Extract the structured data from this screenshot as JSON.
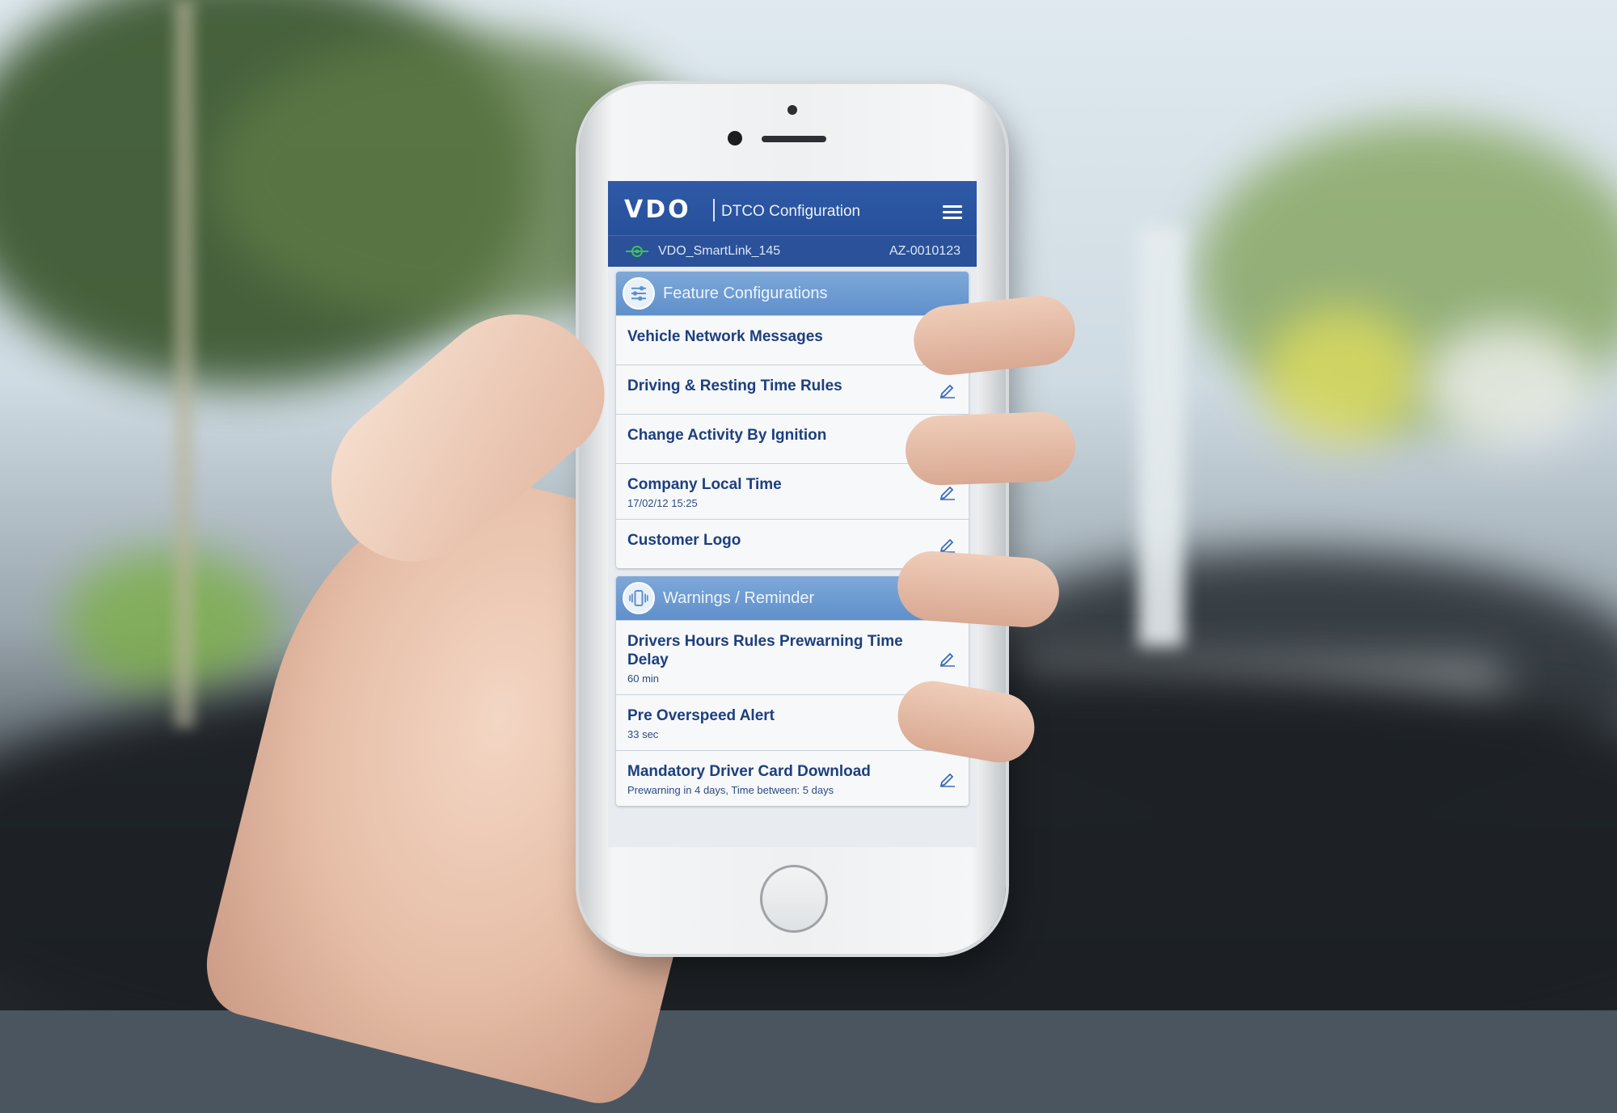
{
  "header": {
    "logo": "VDO",
    "title": "DTCO Configuration",
    "device_name": "VDO_SmartLink_145",
    "serial": "AZ-0010123",
    "menu_icon": "hamburger-menu-icon",
    "connection_icon": "bluetooth-link-icon"
  },
  "feature_configurations": {
    "heading": "Feature Configurations",
    "icon": "sliders-icon",
    "items": [
      {
        "title": "Vehicle Network Messages",
        "subtitle": ""
      },
      {
        "title": "Driving & Resting Time Rules",
        "subtitle": ""
      },
      {
        "title": "Change Activity By Ignition",
        "subtitle": ""
      },
      {
        "title": "Company Local Time",
        "subtitle": "17/02/12 15:25"
      },
      {
        "title": "Customer Logo",
        "subtitle": ""
      }
    ]
  },
  "warnings": {
    "heading": "Warnings / Reminder",
    "icon": "vibrate-phone-icon",
    "items": [
      {
        "title": "Drivers Hours Rules Prewarning Time Delay",
        "subtitle": "60 min"
      },
      {
        "title": "Pre Overspeed Alert",
        "subtitle": "33 sec"
      },
      {
        "title": "Mandatory Driver Card Download",
        "subtitle": "Prewarning in 4 days, Time between: 5 days"
      }
    ]
  },
  "colors": {
    "header_blue": "#2f5aa7",
    "section_blue": "#6f9dd3",
    "text_blue": "#1d3f7e",
    "connection_green": "#3fbf5a"
  }
}
